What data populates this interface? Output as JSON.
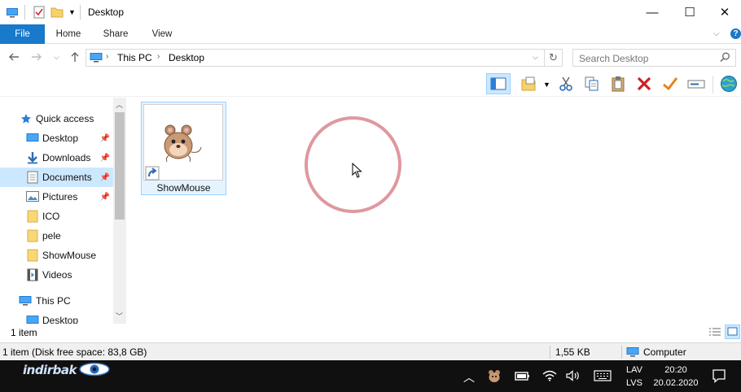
{
  "window": {
    "title": "Desktop",
    "minimize_glyph": "—",
    "maximize_glyph": "☐",
    "close_glyph": "✕"
  },
  "ribbon": {
    "tabs": [
      "File",
      "Home",
      "Share",
      "View"
    ],
    "help_glyph": "?"
  },
  "address": {
    "crumbs": [
      "This PC",
      "Desktop"
    ],
    "search_placeholder": "Search Desktop"
  },
  "navpane": {
    "quick_access_label": "Quick access",
    "items": [
      {
        "label": "Desktop",
        "icon": "desktop-icon",
        "pinned": true
      },
      {
        "label": "Downloads",
        "icon": "download-icon",
        "pinned": true
      },
      {
        "label": "Documents",
        "icon": "document-icon",
        "pinned": true
      },
      {
        "label": "Pictures",
        "icon": "pictures-icon",
        "pinned": true
      },
      {
        "label": "ICO",
        "icon": "folder-icon",
        "pinned": false
      },
      {
        "label": "pele",
        "icon": "folder-icon",
        "pinned": false
      },
      {
        "label": "ShowMouse",
        "icon": "folder-icon",
        "pinned": false
      },
      {
        "label": "Videos",
        "icon": "video-icon",
        "pinned": false
      }
    ],
    "this_pc_label": "This PC",
    "partial_item_label": "Desktop"
  },
  "content": {
    "files": [
      {
        "name": "ShowMouse",
        "icon": "mouse-shortcut-icon"
      }
    ]
  },
  "status": {
    "item_count": "1 item",
    "disk_info": "1 item (Disk free space: 83,8 GB)",
    "size": "1,55 KB",
    "location": "Computer"
  },
  "taskbar": {
    "brand_text": "indirbak",
    "lang_top": "LAV",
    "lang_bottom": "LVS",
    "time": "20:20",
    "date": "20.02.2020"
  },
  "colors": {
    "accent": "#1979ca",
    "selection": "#cce8ff",
    "click_ring": "#d9868e",
    "taskbar": "#101010"
  }
}
